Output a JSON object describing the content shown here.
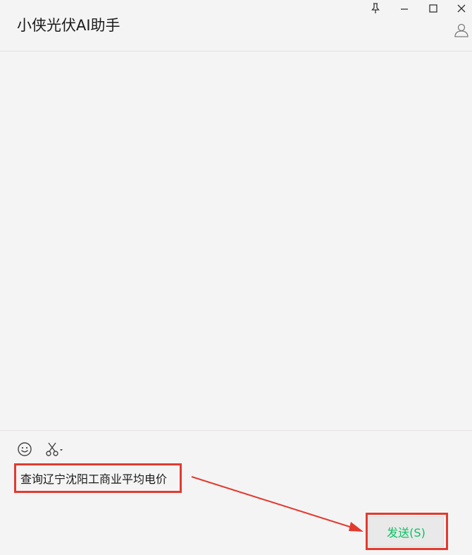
{
  "window": {
    "title": "小侠光伏AI助手",
    "controls": {
      "pin_icon": "pin-icon",
      "minimize_icon": "minimize-icon",
      "maximize_icon": "maximize-icon",
      "close_icon": "close-icon"
    },
    "profile_icon": "user-profile-icon"
  },
  "chat": {
    "messages": []
  },
  "input": {
    "tools": {
      "emoji_icon": "emoji-icon",
      "screenshot_icon": "scissors-icon"
    },
    "current_text": "查询辽宁沈阳工商业平均电价",
    "send_label": "发送(S)"
  },
  "colors": {
    "background": "#f5f4f4",
    "send_text": "#07c160",
    "annotation_red": "#e23a2f"
  }
}
